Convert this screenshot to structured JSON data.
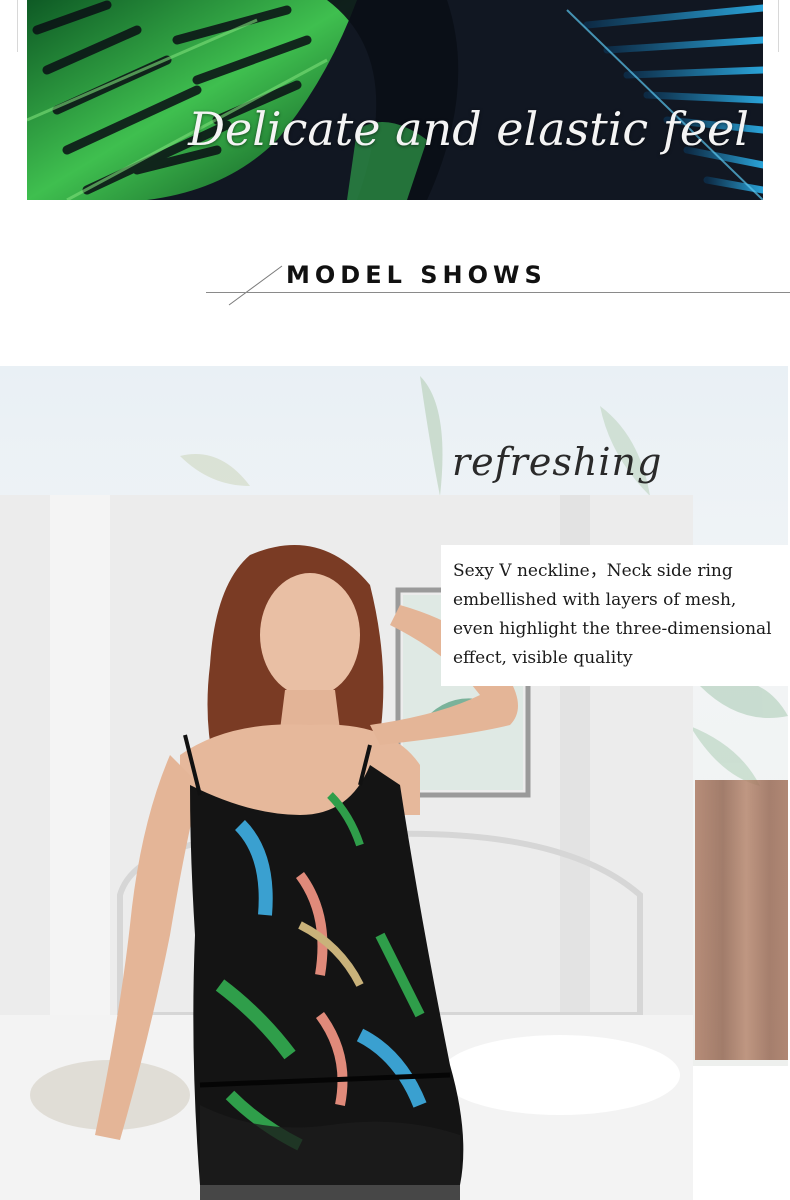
{
  "banner": {
    "caption": "Delicate and elastic feel",
    "fabric_colors": [
      "#1e8a3a",
      "#6fcf6a",
      "#0f1520",
      "#2aa3d8"
    ]
  },
  "section": {
    "title": "MODEL SHOWS"
  },
  "model": {
    "script_word": "refreshing",
    "description": [
      "Sexy V neckline，Neck side ring",
      "embellished with layers of mesh,",
      "even highlight the three-dimensional",
      "effect, visible quality"
    ],
    "dress_print_colors": [
      "#1a1a1a",
      "#3aa0d0",
      "#2f9e4a",
      "#e08a7a",
      "#c9b27a"
    ]
  }
}
